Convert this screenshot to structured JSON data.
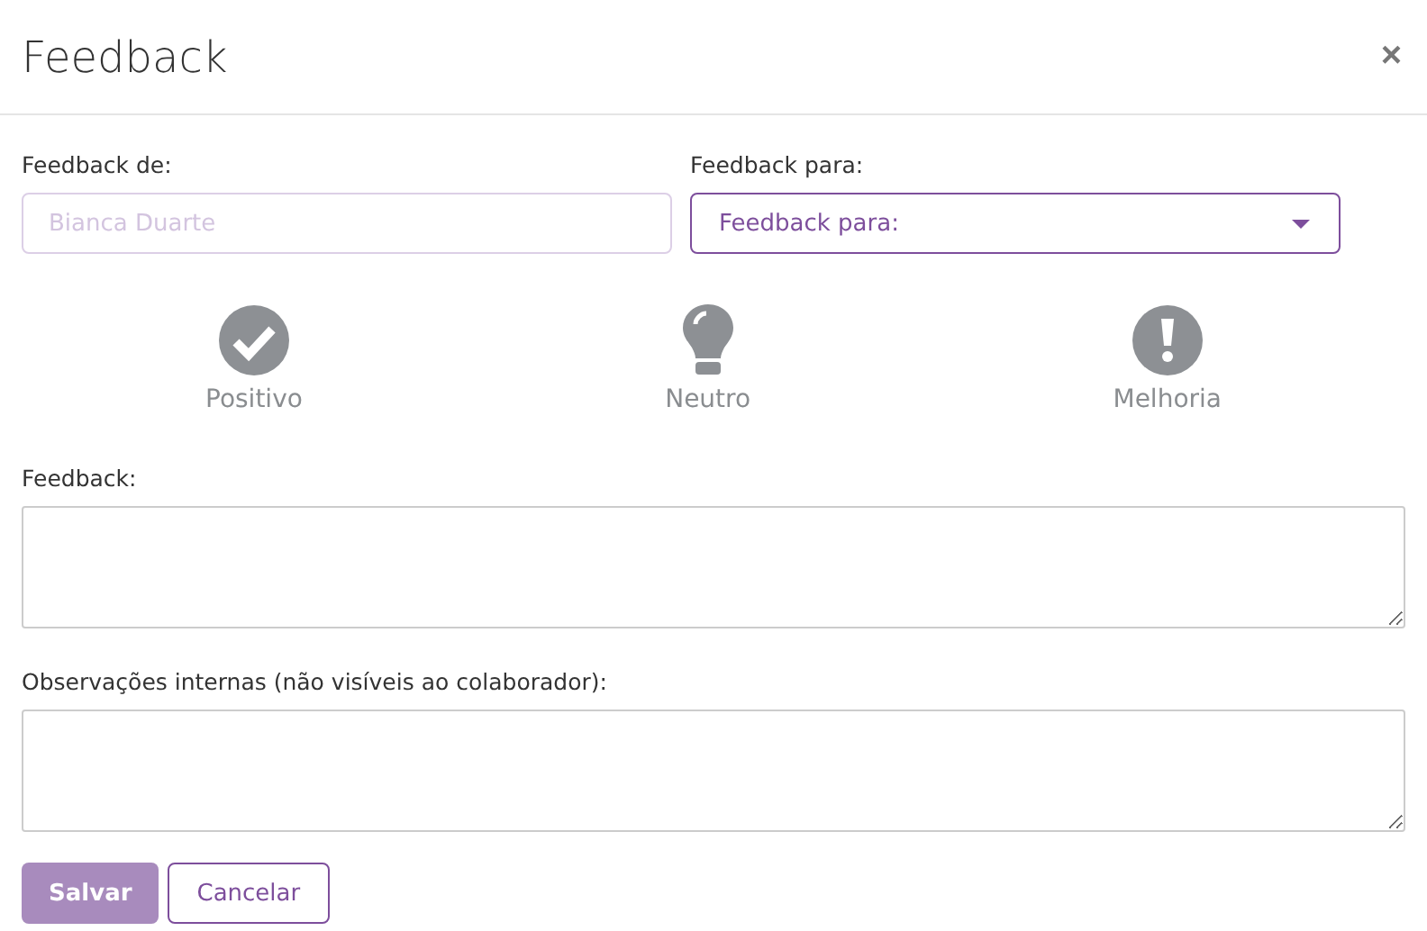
{
  "title": "Feedback",
  "close": "×",
  "from": {
    "label": "Feedback de:",
    "placeholder": "Bianca Duarte"
  },
  "to": {
    "label": "Feedback para:",
    "value": "Feedback para:"
  },
  "types": [
    {
      "kind": "check",
      "label": "Positivo",
      "selected": false
    },
    {
      "kind": "bulb",
      "label": "Neutro",
      "selected": false
    },
    {
      "kind": "alert",
      "label": "Melhoria",
      "selected": false
    }
  ],
  "feedback": {
    "label": "Feedback:"
  },
  "notes": {
    "label": "Observações internas (não visíveis ao colaborador):"
  },
  "save": {
    "label": "Salvar",
    "disabled": true
  },
  "cancel": {
    "label": "Cancelar"
  }
}
